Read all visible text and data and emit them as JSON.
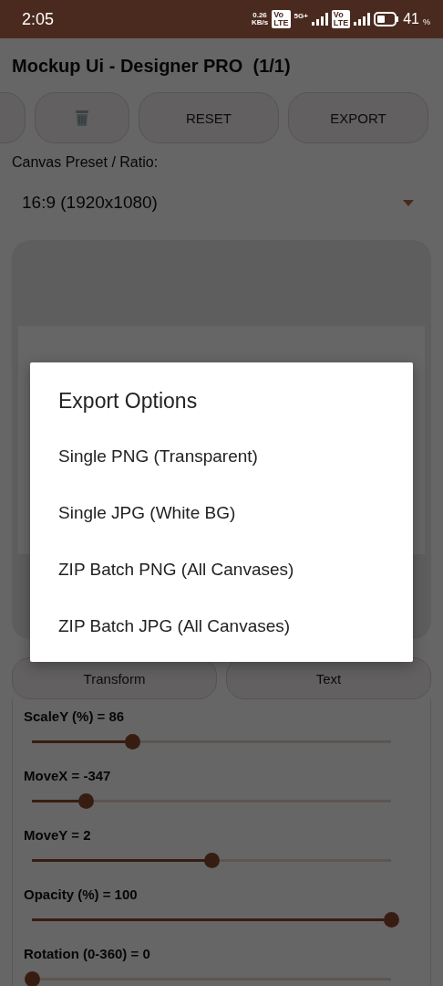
{
  "status_bar": {
    "time": "2:05",
    "net_speed": [
      "0.26",
      "KB/s"
    ],
    "badges": [
      {
        "top": "Vo",
        "bottom": "LTE",
        "network": "5G+"
      },
      {
        "top": "Vo",
        "bottom": "LTE"
      }
    ],
    "battery": "41",
    "battery_unit": "%"
  },
  "title": "Mockup Ui - Designer PRO  (1/1)",
  "toolbar": [
    {
      "kind": "partial"
    },
    {
      "kind": "trash"
    },
    {
      "kind": "text",
      "label": "RESET"
    },
    {
      "kind": "text",
      "label": "EXPORT"
    }
  ],
  "preset": {
    "label": "Canvas Preset / Ratio:",
    "value": "16:9 (1920x1080)"
  },
  "tabs": [
    {
      "label": "Transform",
      "selected": false
    },
    {
      "label": "Text",
      "selected": false
    }
  ],
  "sliders": [
    {
      "label": "ScaleY (%) = 86",
      "level": 0.28
    },
    {
      "label": "MoveX = -347",
      "level": 0.15
    },
    {
      "label": "MoveY = 2",
      "level": 0.5
    },
    {
      "label": "Opacity (%) = 100",
      "level": 1
    },
    {
      "label": "Rotation (0-360) = 0",
      "level": 0
    }
  ],
  "dialog": {
    "title": "Export Options",
    "options": [
      "Single PNG (Transparent)",
      "Single JPG (White BG)",
      "ZIP Batch PNG (All Canvases)",
      "ZIP Batch JPG (All Canvases)"
    ]
  }
}
